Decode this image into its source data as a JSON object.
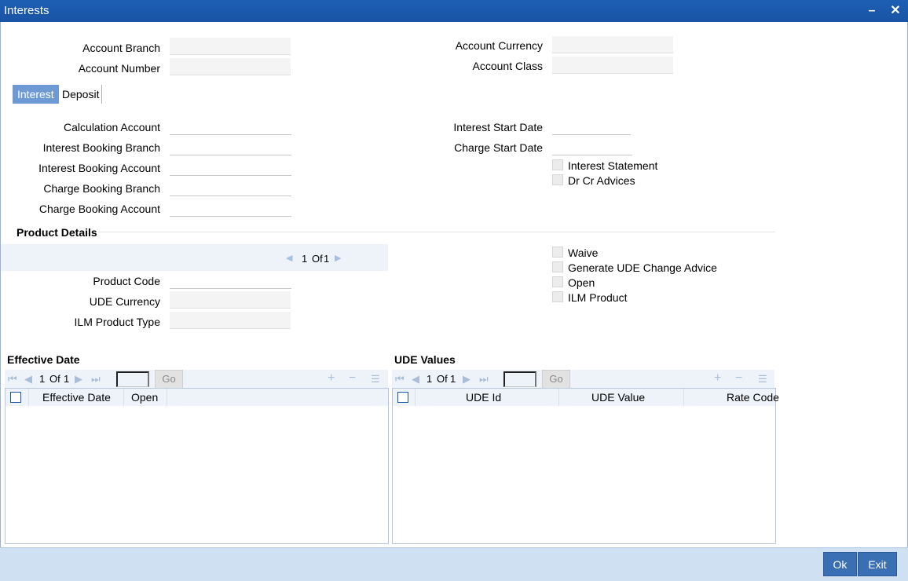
{
  "window": {
    "title": "Interests",
    "minimize_symbol": "–",
    "close_symbol": "✕"
  },
  "header_fields": {
    "account_branch": {
      "label": "Account Branch",
      "value": ""
    },
    "account_number": {
      "label": "Account Number",
      "value": ""
    },
    "account_currency": {
      "label": "Account Currency",
      "value": ""
    },
    "account_class": {
      "label": "Account Class",
      "value": ""
    }
  },
  "tabs": [
    {
      "label": "Interest",
      "active": true
    },
    {
      "label": "Deposit",
      "active": false
    }
  ],
  "interest": {
    "calculation_account": {
      "label": "Calculation Account",
      "value": ""
    },
    "interest_booking_branch": {
      "label": "Interest Booking Branch",
      "value": ""
    },
    "interest_booking_account": {
      "label": "Interest Booking Account",
      "value": ""
    },
    "charge_booking_branch": {
      "label": "Charge Booking Branch",
      "value": ""
    },
    "charge_booking_account": {
      "label": "Charge Booking Account",
      "value": ""
    },
    "interest_start_date": {
      "label": "Interest Start Date",
      "value": ""
    },
    "charge_start_date": {
      "label": "Charge Start Date",
      "value": ""
    },
    "interest_statement": {
      "label": "Interest Statement",
      "checked": false
    },
    "dr_cr_advices": {
      "label": "Dr Cr Advices",
      "checked": false
    }
  },
  "product_details": {
    "title": "Product Details",
    "pager": {
      "current": "1",
      "of": "Of",
      "total": "1"
    },
    "product_code": {
      "label": "Product Code",
      "value": ""
    },
    "ude_currency": {
      "label": "UDE Currency",
      "value": ""
    },
    "ilm_product_type": {
      "label": "ILM Product Type",
      "value": ""
    },
    "waive": {
      "label": "Waive",
      "checked": false
    },
    "generate_ude_change_advice": {
      "label": "Generate UDE Change Advice",
      "checked": false
    },
    "open": {
      "label": "Open",
      "checked": false
    },
    "ilm_product": {
      "label": "ILM Product",
      "checked": false
    }
  },
  "effective_date_grid": {
    "title": "Effective Date",
    "pager": {
      "current": "1",
      "of": "Of",
      "total": "1"
    },
    "go_label": "Go",
    "columns": [
      "Effective Date",
      "Open"
    ]
  },
  "ude_values_grid": {
    "title": "UDE Values",
    "pager": {
      "current": "1",
      "of": "Of",
      "total": "1"
    },
    "go_label": "Go",
    "columns": [
      "UDE Id",
      "UDE Value",
      "Rate Code"
    ]
  },
  "footer": {
    "ok_label": "Ok",
    "exit_label": "Exit"
  }
}
